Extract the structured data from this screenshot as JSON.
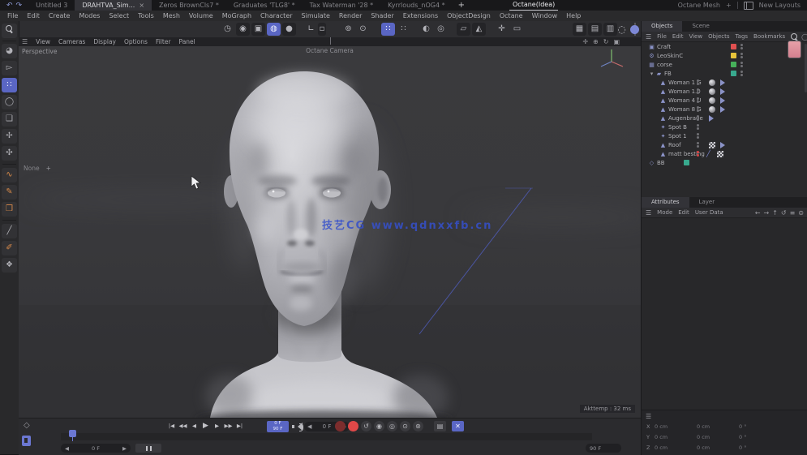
{
  "colors": {
    "accent_blue": "#5a66c4",
    "watermark_blue": "#3550cc",
    "record_red": "#e04848",
    "chip_red": "#e05050",
    "chip_yellow": "#e6c33a",
    "chip_green": "#46b05a",
    "chip_teal": "#38a98e",
    "tool_orange": "#d98b4a"
  },
  "title_bar": {
    "undo_icon": "↶",
    "redo_icon": "↷",
    "tabs": [
      {
        "label": "Untitled 3"
      },
      {
        "label": "DRAHTVA_Sim...",
        "close": "×"
      },
      {
        "label": "Zeros BrownCls7 *"
      },
      {
        "label": "Graduates 'TLG8' *"
      },
      {
        "label": "Tax Waterman '28 *"
      },
      {
        "label": "Kyrrlouds_nOG4 *"
      }
    ],
    "add_tab": "+",
    "highlight_tab": "Octane(Idea)",
    "right_tab": "Octane Mesh",
    "right_add": "+",
    "layout_label": "New Layouts"
  },
  "menu_bar": {
    "items": [
      "File",
      "Edit",
      "Create",
      "Modes",
      "Select",
      "Tools",
      "Mesh",
      "Volume",
      "MoGraph",
      "Character",
      "Simulate",
      "Render",
      "Shader",
      "Extensions",
      "ObjectDesign",
      "Octane",
      "Window",
      "Help"
    ]
  },
  "main_toolbar": {
    "icons": [
      {
        "name": "history",
        "glyph": "◷"
      },
      {
        "name": "live-selection",
        "glyph": "◉"
      },
      {
        "name": "rect-selection",
        "glyph": "▣"
      },
      {
        "name": "move-tool",
        "glyph": "◍"
      },
      {
        "name": "simulate-tool",
        "glyph": "●"
      },
      {
        "name": "workplane-axis",
        "glyph": "∟"
      },
      {
        "name": "axis-box",
        "glyph": "▫"
      },
      {
        "name": "coord-system",
        "glyph": "⊚"
      },
      {
        "name": "coord-world",
        "glyph": "⊙"
      },
      {
        "name": "snap-grid",
        "glyph": "∷"
      },
      {
        "name": "quantize",
        "glyph": "∷"
      },
      {
        "name": "make-editable",
        "glyph": "◐"
      },
      {
        "name": "model-mode",
        "glyph": "◎"
      },
      {
        "name": "texture-mode",
        "glyph": "▱"
      },
      {
        "name": "workplane-mode",
        "glyph": "◭"
      },
      {
        "name": "viewport-filter",
        "glyph": "✛"
      },
      {
        "name": "frame-region",
        "glyph": "▭"
      },
      {
        "name": "render-view",
        "glyph": "▦"
      },
      {
        "name": "render-region",
        "glyph": "▤"
      },
      {
        "name": "render-settings",
        "glyph": "▥"
      },
      {
        "name": "interactive-render",
        "glyph": "◌"
      }
    ]
  },
  "left_toolbar": {
    "icons": [
      {
        "name": "live-selection",
        "glyph": "◕"
      },
      {
        "name": "select",
        "glyph": "▻"
      },
      {
        "name": "move",
        "glyph": "∷"
      },
      {
        "name": "rotate",
        "glyph": "◯"
      },
      {
        "name": "scale",
        "glyph": "❑"
      },
      {
        "name": "transform",
        "glyph": "✢"
      },
      {
        "name": "snap",
        "glyph": "✣"
      },
      {
        "name": "spline-pen",
        "glyph": "∿"
      },
      {
        "name": "pen",
        "glyph": "✎"
      },
      {
        "name": "poly-tools",
        "glyph": "❒"
      },
      {
        "name": "knife",
        "glyph": "╱"
      },
      {
        "name": "brush",
        "glyph": "✐"
      },
      {
        "name": "stamp",
        "glyph": "❖"
      }
    ]
  },
  "viewport": {
    "menu_icon": "☰",
    "menus": [
      "View",
      "Cameras",
      "Display",
      "Options",
      "Filter",
      "Panel"
    ],
    "nav_icons": [
      "✛",
      "⊕",
      "↻",
      "▣"
    ],
    "label": "Perspective",
    "camera_label": "Octane Camera",
    "hud_item": "None",
    "hud_add": "+",
    "watermark": "技艺CG  www.qdnxxfb.cn",
    "stat": "Akttemp : 32 ms"
  },
  "object_manager": {
    "tabs": [
      "Objects",
      "Scene"
    ],
    "menu_icon": "☰",
    "menus": [
      "File",
      "Edit",
      "View",
      "Objects",
      "Tags",
      "Bookmarks"
    ],
    "search_icons": [
      "◯",
      "≡",
      "⧉"
    ],
    "rows": [
      {
        "label": "Craft"
      },
      {
        "label": "LeoSkinC"
      },
      {
        "label": "corse"
      },
      {
        "label": "FB",
        "arrow": "▾"
      },
      {
        "label": "Woman 1 G"
      },
      {
        "label": "Woman 1.0"
      },
      {
        "label": "Woman 4 U"
      },
      {
        "label": "Woman 8 G"
      },
      {
        "label": "Augenbraue"
      },
      {
        "label": "Spot B"
      },
      {
        "label": "Spot 1"
      },
      {
        "label": "Roof"
      },
      {
        "label": "matt besting"
      },
      {
        "label": "BB"
      }
    ]
  },
  "attributes_panel": {
    "tabs": [
      "Attributes",
      "Layer"
    ],
    "menu_icon": "☰",
    "menus": [
      "Mode",
      "Edit",
      "User Data"
    ],
    "nav_icons": [
      "←",
      "→",
      "↑",
      "↺",
      "≡",
      "⊜"
    ]
  },
  "coordinate_manager": {
    "menu_icon": "☰",
    "rows": [
      {
        "axis": "X",
        "position": "0 cm",
        "size": "0 cm",
        "rotation": "0 °"
      },
      {
        "axis": "Y",
        "position": "0 cm",
        "size": "0 cm",
        "rotation": "0 °"
      },
      {
        "axis": "Z",
        "position": "0 cm",
        "size": "0 cm",
        "rotation": "0 °"
      }
    ]
  },
  "timeline": {
    "marker_icon": "◇",
    "playback": [
      "|◀",
      "◀◀",
      "◀",
      "▶",
      "▶",
      "▶▶",
      "▶|"
    ],
    "frame_info_top": "0 F",
    "frame_info_bottom": "90 F",
    "field_left_arrow": "◀",
    "field_right_arrow": "▶",
    "current_frame": "0 F",
    "range_start": "0 F",
    "range_end": "90 F",
    "record_icons": [
      {
        "name": "record-off",
        "glyph": "●"
      },
      {
        "name": "record-on",
        "glyph": "●"
      },
      {
        "name": "autokey",
        "glyph": "↺"
      },
      {
        "name": "keyframe-position",
        "glyph": "◉"
      },
      {
        "name": "keyframe-scale",
        "glyph": "◎"
      },
      {
        "name": "keyframe-rotation",
        "glyph": "⊙"
      },
      {
        "name": "keyframe-parameter",
        "glyph": "⊛"
      },
      {
        "name": "selection-box",
        "glyph": "▤"
      },
      {
        "name": "keyframe-selection",
        "glyph": "✕"
      }
    ]
  }
}
